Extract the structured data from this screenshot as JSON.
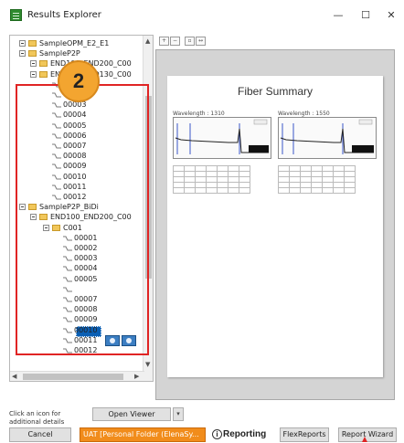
{
  "window": {
    "title": "Results Explorer",
    "minimize_glyph": "—",
    "maximize_glyph": "☐",
    "close_glyph": "✕"
  },
  "step_badge": "2",
  "tree": {
    "items": [
      {
        "label": "SampleOPM_E2_E1",
        "kind": "folder",
        "level": 1,
        "expander": true
      },
      {
        "label": "SampleP2P",
        "kind": "folder",
        "level": 1,
        "expander": true
      },
      {
        "label": "END100_END200_C00",
        "kind": "folder",
        "level": 2,
        "expander": true
      },
      {
        "label": "END100_END130_C00",
        "kind": "folder",
        "level": 2,
        "expander": true
      },
      {
        "label": "",
        "kind": "trace",
        "level": 3
      },
      {
        "label": "00002",
        "kind": "trace",
        "level": 3
      },
      {
        "label": "00003",
        "kind": "trace",
        "level": 3
      },
      {
        "label": "00004",
        "kind": "trace",
        "level": 3
      },
      {
        "label": "00005",
        "kind": "trace",
        "level": 3
      },
      {
        "label": "00006",
        "kind": "trace",
        "level": 3
      },
      {
        "label": "00007",
        "kind": "trace",
        "level": 3
      },
      {
        "label": "00008",
        "kind": "trace",
        "level": 3
      },
      {
        "label": "00009",
        "kind": "trace",
        "level": 3
      },
      {
        "label": "00010",
        "kind": "trace",
        "level": 3
      },
      {
        "label": "00011",
        "kind": "trace",
        "level": 3
      },
      {
        "label": "00012",
        "kind": "trace",
        "level": 3
      },
      {
        "label": "SampleP2P_BiDi",
        "kind": "folder",
        "level": 1,
        "expander": true
      },
      {
        "label": "END100_END200_C00",
        "kind": "folder",
        "level": 2,
        "expander": true
      },
      {
        "label": "C001",
        "kind": "folder",
        "level": 3,
        "expander": true
      },
      {
        "label": "00001",
        "kind": "trace",
        "level": 4
      },
      {
        "label": "00002",
        "kind": "trace",
        "level": 4
      },
      {
        "label": "00003",
        "kind": "trace",
        "level": 4
      },
      {
        "label": "00004",
        "kind": "trace",
        "level": 4
      },
      {
        "label": "00005",
        "kind": "trace",
        "level": 4
      },
      {
        "label": "",
        "kind": "trace-selected",
        "level": 4
      },
      {
        "label": "00007",
        "kind": "trace",
        "level": 4
      },
      {
        "label": "00008",
        "kind": "trace",
        "level": 4
      },
      {
        "label": "00009",
        "kind": "trace",
        "level": 4
      },
      {
        "label": "00010",
        "kind": "trace",
        "level": 4
      },
      {
        "label": "00011",
        "kind": "trace",
        "level": 4
      },
      {
        "label": "00012",
        "kind": "trace",
        "level": 4
      }
    ]
  },
  "preview": {
    "page_title": "Fiber Summary",
    "wavelength_left": "Wavelength : 1310",
    "wavelength_right": "Wavelength : 1550"
  },
  "bottom": {
    "hint": "Click an icon for additional details",
    "open_viewer": "Open Viewer",
    "dropdown_glyph": "▾",
    "cancel": "Cancel",
    "folder": "UAT [Personal Folder (ElenaSy...",
    "reporting_icon": "i",
    "reporting": "Reporting",
    "flexreports": "FlexReports",
    "report_wizard": "Report Wizard"
  },
  "colors": {
    "accent_orange": "#f18c1b",
    "highlight_red": "#e02424",
    "selection_blue": "#0a5fb4",
    "step_badge": "#f3a530"
  }
}
